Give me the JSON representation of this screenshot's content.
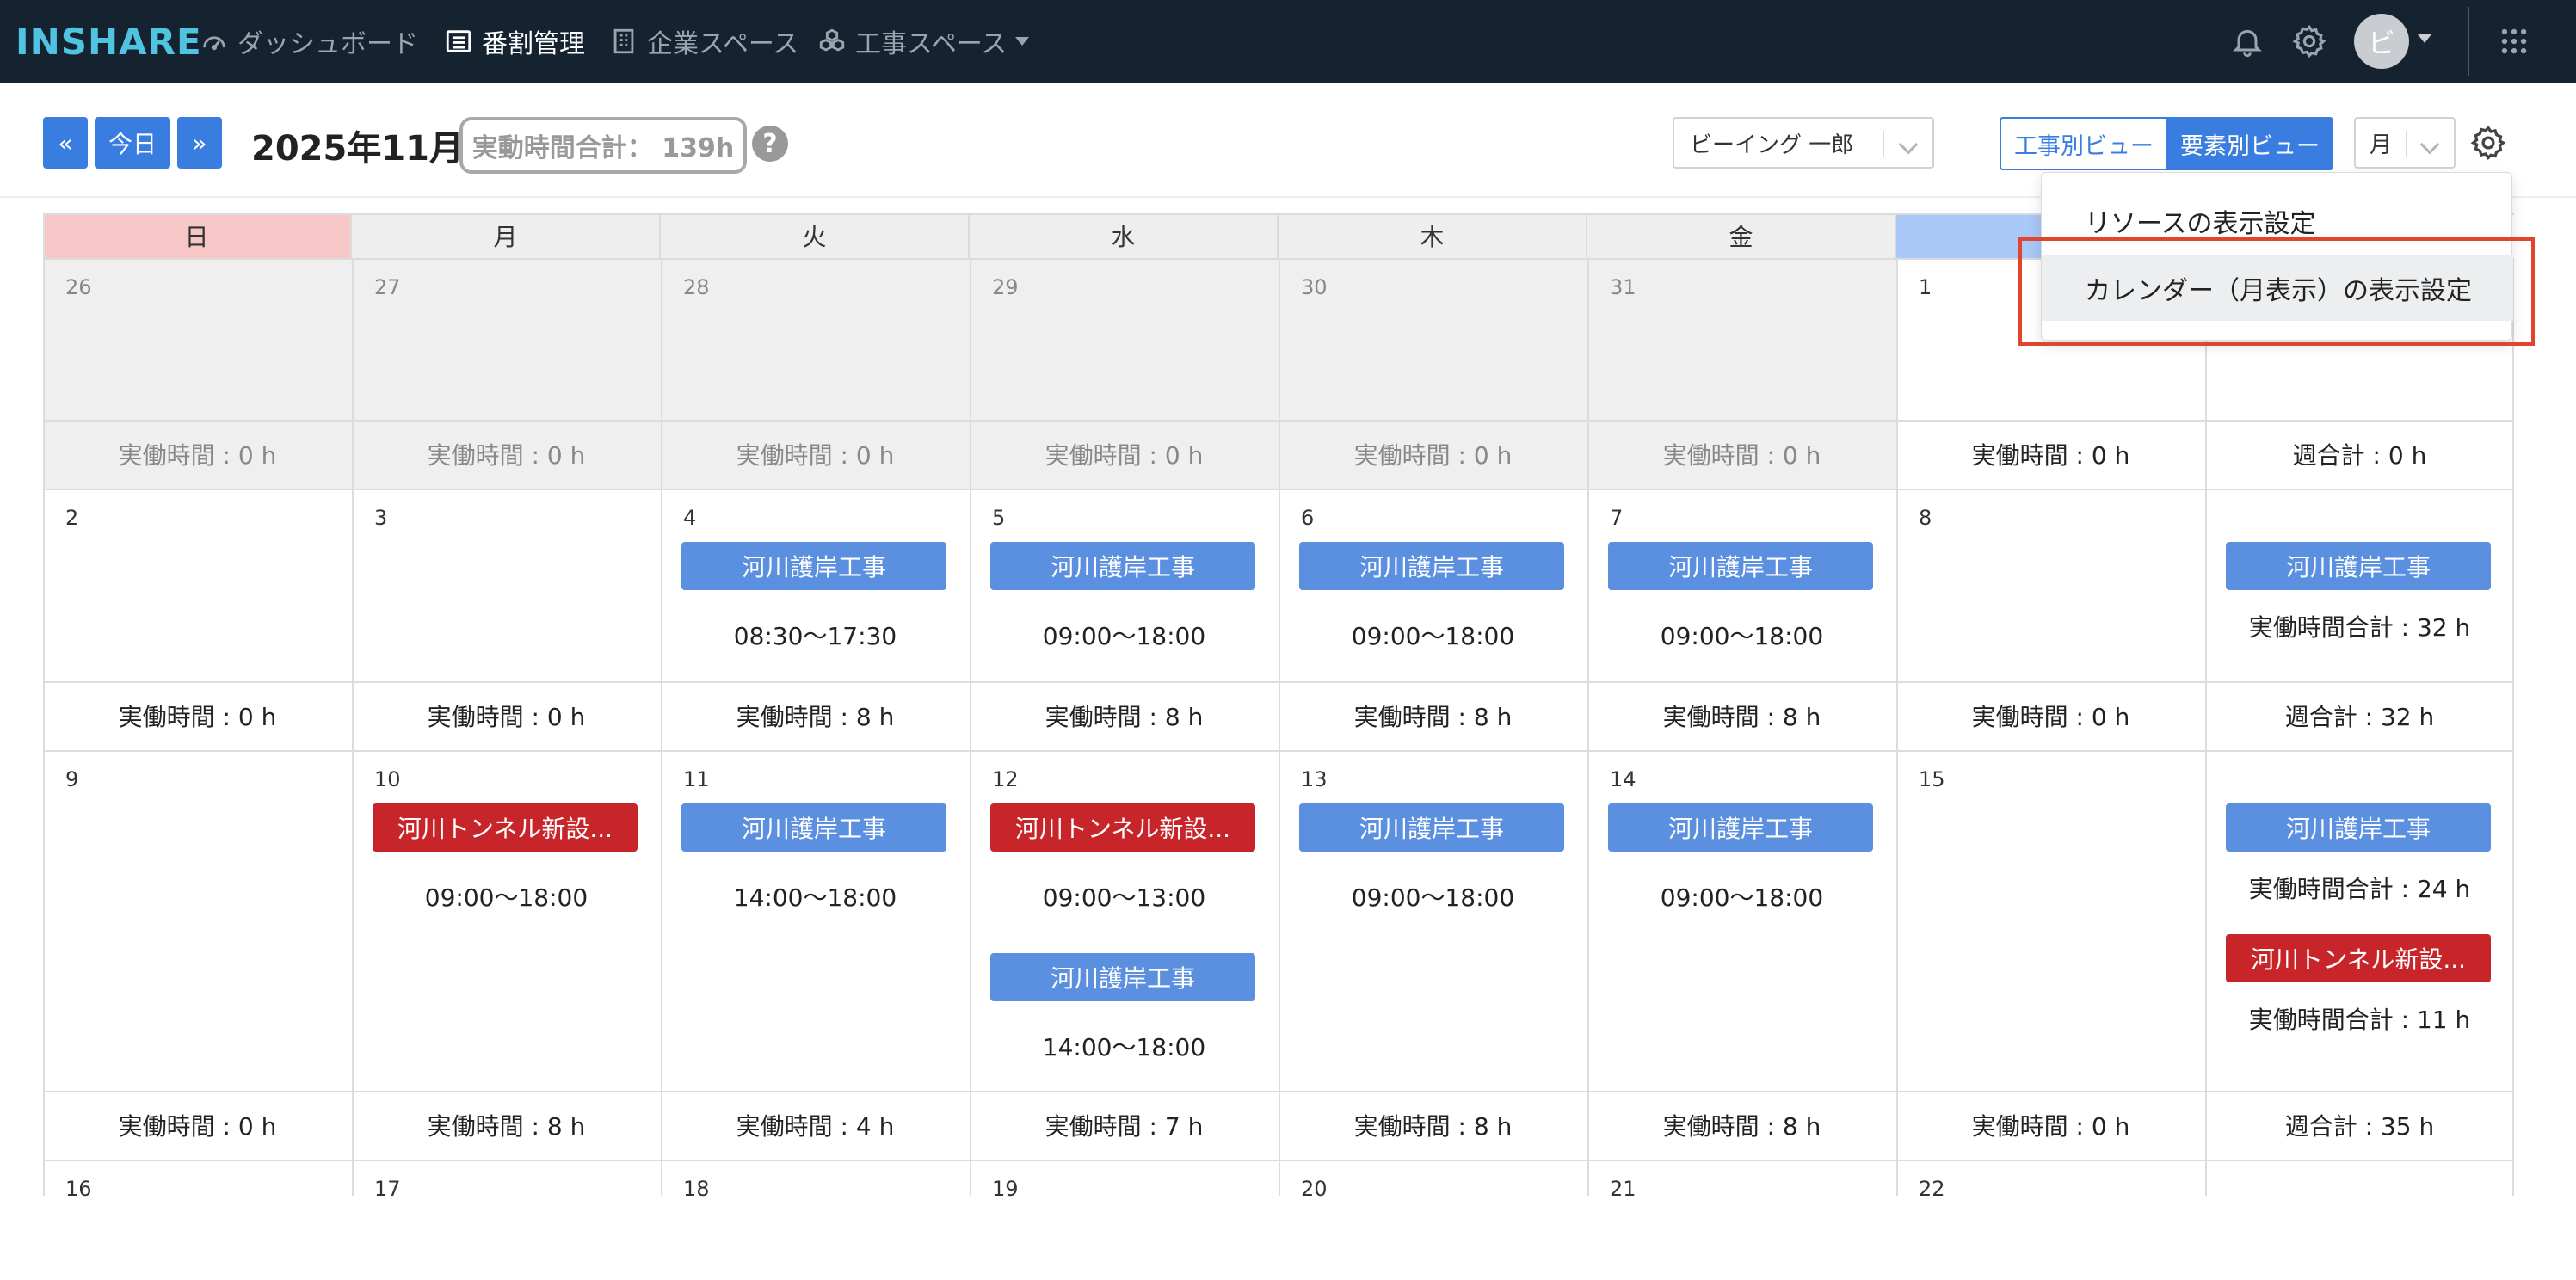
{
  "nav": {
    "logo": "INSHARE",
    "items": [
      {
        "label": "ダッシュボード"
      },
      {
        "label": "番割管理"
      },
      {
        "label": "企業スペース"
      },
      {
        "label": "工事スペース"
      }
    ],
    "avatar_initial": "ビ"
  },
  "toolbar": {
    "prev_label": "«",
    "today_label": "今日",
    "next_label": "»",
    "month_title": "2025年11月",
    "total_hours": "実動時間合計： 139h",
    "help_label": "?",
    "person_select": "ビーイング 一郎",
    "view_construction": "工事別ビュー",
    "view_element": "要素別ビュー",
    "period_select": "月"
  },
  "calendar": {
    "weekdays": [
      "日",
      "月",
      "火",
      "水",
      "木",
      "金",
      ""
    ],
    "weeks": [
      {
        "days": [
          {
            "num": "26",
            "past": true,
            "events": [],
            "summary": "実働時間 : 0 h"
          },
          {
            "num": "27",
            "past": true,
            "events": [],
            "summary": "実働時間 : 0 h"
          },
          {
            "num": "28",
            "past": true,
            "events": [],
            "summary": "実働時間 : 0 h"
          },
          {
            "num": "29",
            "past": true,
            "events": [],
            "summary": "実働時間 : 0 h"
          },
          {
            "num": "30",
            "past": true,
            "events": [],
            "summary": "実働時間 : 0 h"
          },
          {
            "num": "31",
            "past": true,
            "events": [],
            "summary": "実働時間 : 0 h"
          },
          {
            "num": "1",
            "past": false,
            "events": [],
            "summary": "実働時間 : 0 h"
          }
        ],
        "week_col": {
          "events": [],
          "summary": "週合計 : 0 h"
        }
      },
      {
        "days": [
          {
            "num": "2",
            "past": false,
            "events": [],
            "summary": "実働時間 : 0 h"
          },
          {
            "num": "3",
            "past": false,
            "events": [],
            "summary": "実働時間 : 0 h"
          },
          {
            "num": "4",
            "past": false,
            "events": [
              {
                "name": "河川護岸工事",
                "color": "blue",
                "time": "08:30〜17:30"
              }
            ],
            "summary": "実働時間 : 8 h"
          },
          {
            "num": "5",
            "past": false,
            "events": [
              {
                "name": "河川護岸工事",
                "color": "blue",
                "time": "09:00〜18:00"
              }
            ],
            "summary": "実働時間 : 8 h"
          },
          {
            "num": "6",
            "past": false,
            "events": [
              {
                "name": "河川護岸工事",
                "color": "blue",
                "time": "09:00〜18:00"
              }
            ],
            "summary": "実働時間 : 8 h"
          },
          {
            "num": "7",
            "past": false,
            "events": [
              {
                "name": "河川護岸工事",
                "color": "blue",
                "time": "09:00〜18:00"
              }
            ],
            "summary": "実働時間 : 8 h"
          },
          {
            "num": "8",
            "past": false,
            "events": [],
            "summary": "実働時間 : 0 h"
          }
        ],
        "week_col": {
          "events": [
            {
              "name": "河川護岸工事",
              "color": "blue",
              "time": "実働時間合計 : 32 h"
            }
          ],
          "summary": "週合計 : 32 h"
        }
      },
      {
        "days": [
          {
            "num": "9",
            "past": false,
            "events": [],
            "summary": "実働時間 : 0 h"
          },
          {
            "num": "10",
            "past": false,
            "events": [
              {
                "name": "河川トンネル新設...",
                "color": "red",
                "time": "09:00〜18:00"
              }
            ],
            "summary": "実働時間 : 8 h"
          },
          {
            "num": "11",
            "past": false,
            "events": [
              {
                "name": "河川護岸工事",
                "color": "blue",
                "time": "14:00〜18:00"
              }
            ],
            "summary": "実働時間 : 4 h"
          },
          {
            "num": "12",
            "past": false,
            "events": [
              {
                "name": "河川トンネル新設...",
                "color": "red",
                "time": "09:00〜13:00"
              },
              {
                "name": "河川護岸工事",
                "color": "blue",
                "time": "14:00〜18:00"
              }
            ],
            "summary": "実働時間 : 7 h"
          },
          {
            "num": "13",
            "past": false,
            "events": [
              {
                "name": "河川護岸工事",
                "color": "blue",
                "time": "09:00〜18:00"
              }
            ],
            "summary": "実働時間 : 8 h"
          },
          {
            "num": "14",
            "past": false,
            "events": [
              {
                "name": "河川護岸工事",
                "color": "blue",
                "time": "09:00〜18:00"
              }
            ],
            "summary": "実働時間 : 8 h"
          },
          {
            "num": "15",
            "past": false,
            "events": [],
            "summary": "実働時間 : 0 h"
          }
        ],
        "week_col": {
          "events": [
            {
              "name": "河川護岸工事",
              "color": "blue",
              "time": "実働時間合計 : 24 h"
            },
            {
              "name": "河川トンネル新設...",
              "color": "red",
              "time": "実働時間合計 : 11 h"
            }
          ],
          "summary": "週合計 : 35 h"
        }
      },
      {
        "days": [
          {
            "num": "16"
          },
          {
            "num": "17"
          },
          {
            "num": "18"
          },
          {
            "num": "19"
          },
          {
            "num": "20"
          },
          {
            "num": "21"
          },
          {
            "num": "22"
          }
        ]
      }
    ]
  },
  "dropdown": {
    "items": [
      {
        "label": "リソースの表示設定"
      },
      {
        "label": "カレンダー（月表示）の表示設定"
      }
    ]
  },
  "colors": {
    "nav_bg": "#152230",
    "primary": "#3a7de0",
    "event_blue": "#5b8fe0",
    "event_red": "#c8252b",
    "sunday_header": "#f7c7c7",
    "saturday_header": "#a9c7f7",
    "highlight": "#e0452e"
  }
}
